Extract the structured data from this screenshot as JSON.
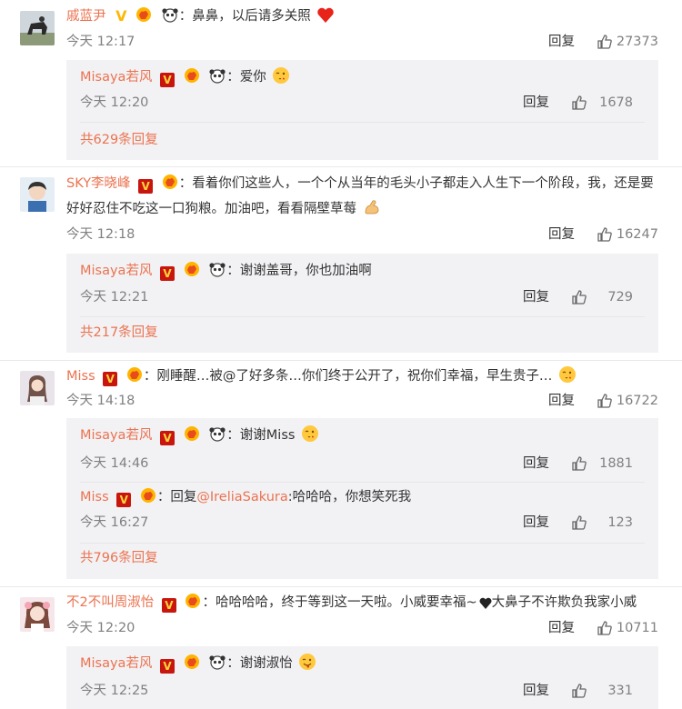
{
  "colors": {
    "username": "#eb7350",
    "time": "#808080",
    "reply_bg": "#f2f2f5",
    "verified_red": "#c8160e",
    "verified_yellow": "#ffb800"
  },
  "icons": {
    "like": "thumbs-up-icon",
    "verified": "verified-v-icon",
    "vip": "vip-hand-icon",
    "fan": "panda-icon"
  },
  "labels": {
    "reply": "回复",
    "separator": "："
  },
  "comments": [
    {
      "username": "戚蓝尹",
      "text": "鼻鼻，以后请多关照",
      "time": "今天 12:17",
      "likes": "27373",
      "emoji": "heart-icon",
      "replies": [
        {
          "username": "Misaya若风",
          "text": "爱你",
          "emoji": "kiss-face-icon",
          "time": "今天 12:20",
          "likes": "1678"
        }
      ],
      "more": "共629条回复"
    },
    {
      "username": "SKY李晓峰",
      "text": "看着你们这些人，一个个从当年的毛头小子都走入人生下一个阶段，我，还是要好好忍住不吃这一口狗粮。加油吧，看看隔壁草莓",
      "time": "今天 12:18",
      "likes": "16247",
      "emoji": "flexed-arm-icon",
      "replies": [
        {
          "username": "Misaya若风",
          "text": "谢谢盖哥，你也加油啊",
          "time": "今天 12:21",
          "likes": "729"
        }
      ],
      "more": "共217条回复"
    },
    {
      "username": "Miss",
      "text": "刚睡醒…被@了好多条…你们终于公开了，祝你们幸福，早生贵子…",
      "time": "今天 14:18",
      "likes": "16722",
      "emoji": "kiss-face-icon",
      "replies": [
        {
          "username": "Misaya若风",
          "text": "谢谢Miss",
          "emoji": "kiss-face-icon",
          "time": "今天 14:46",
          "likes": "1881"
        },
        {
          "username": "Miss",
          "prefix": "回复",
          "mention": "@IreliaSakura",
          "text": ":哈哈哈，你想笑死我",
          "time": "今天 16:27",
          "likes": "123"
        }
      ],
      "more": "共796条回复"
    },
    {
      "username": "不2不叫周淑怡",
      "text": "哈哈哈哈，终于等到这一天啦。小威要幸福~",
      "text2": "大鼻子不许欺负我家小威",
      "time": "今天 12:20",
      "likes": "10711",
      "replies": [
        {
          "username": "Misaya若风",
          "text": "谢谢淑怡",
          "emoji": "tongue-face-icon",
          "time": "今天 12:25",
          "likes": "331"
        }
      ]
    }
  ]
}
